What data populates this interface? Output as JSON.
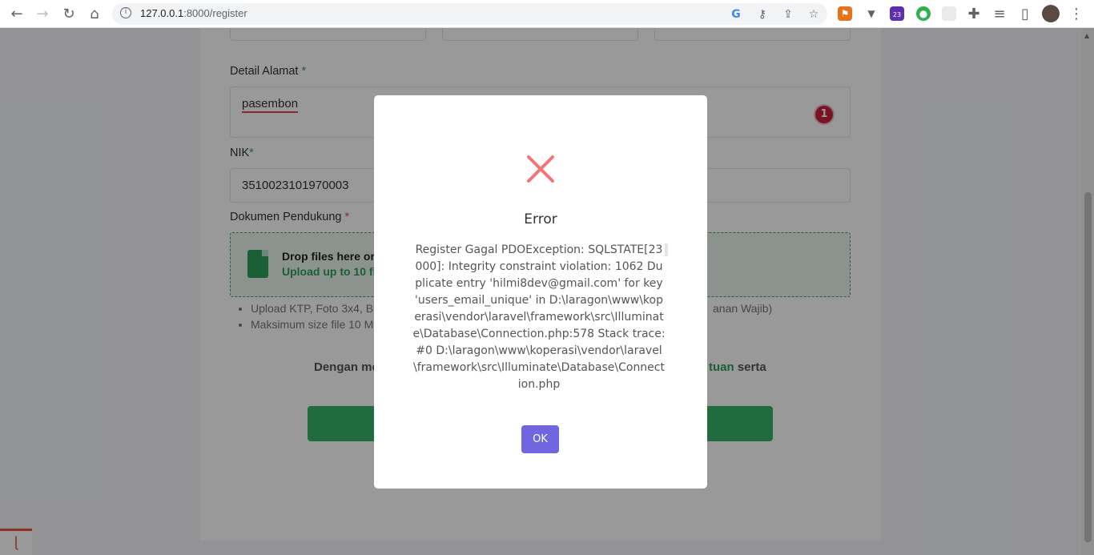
{
  "browser": {
    "url_host": "127.0.0.1",
    "url_path": ":8000/register",
    "extension_badge": "23"
  },
  "form": {
    "detail_label": "Detail Alamat",
    "detail_required": "*",
    "detail_value": "pasembon",
    "error_count": "1",
    "nik_label": "NIK",
    "nik_required": "*",
    "nik_value": "3510023101970003",
    "docs_label": "Dokumen Pendukung",
    "docs_required": "*",
    "drop_text": "Drop files here or c",
    "upload_text": "Upload up to 10 fil",
    "note_1": "Upload KTP, Foto 3x4, Bu",
    "note_1_tail": "anan Wajib)",
    "note_2": "Maksimum size file 10 M",
    "terms_left": "Dengan me",
    "terms_link": "tuan",
    "terms_right": "serta"
  },
  "modal": {
    "title": "Error",
    "message": "Register Gagal PDOException: SQLSTATE[23000]: Integrity constraint violation: 1062 Duplicate entry 'hilmi8dev@gmail.com' for key 'users_email_unique' in D:\\laragon\\www\\koperasi\\vendor\\laravel\\framework\\src\\Illuminate\\Database\\Connection.php:578 Stack trace: #0 D:\\laragon\\www\\koperasi\\vendor\\laravel\\framework\\src\\Illuminate\\Database\\Connection.php",
    "ok_label": "OK"
  },
  "colors": {
    "accent_green": "#36b46a",
    "error_red": "#f27474",
    "ok_button": "#7066e0"
  }
}
